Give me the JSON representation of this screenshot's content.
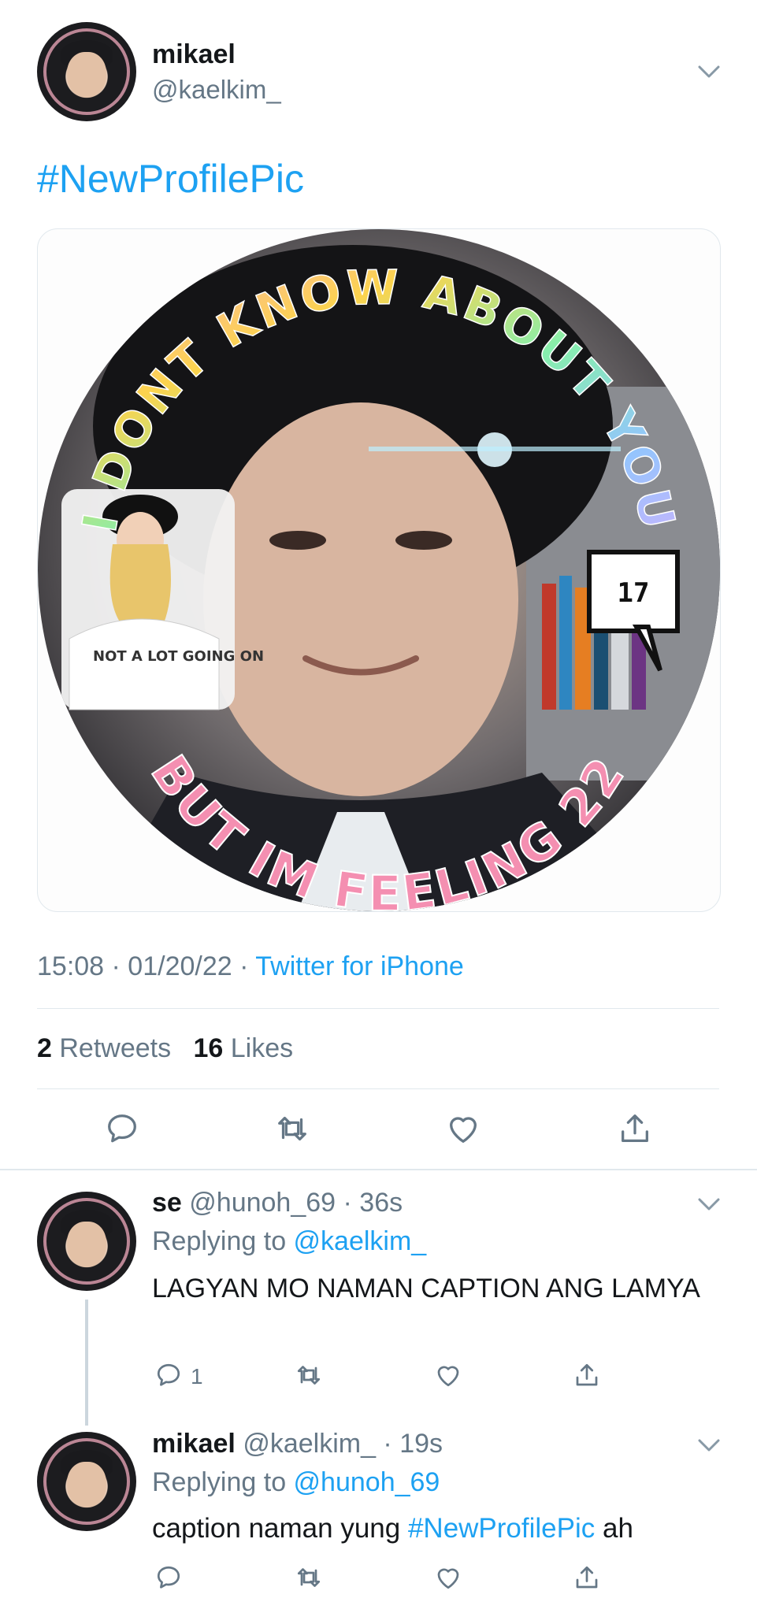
{
  "tweet": {
    "author_name": "mikael",
    "author_handle": "@kaelkim_",
    "text_hashtag": "#NewProfilePic",
    "timestamp": "15:08 · 01/20/22 · ",
    "source": "Twitter for iPhone",
    "retweets_count": "2",
    "retweets_label": "Retweets",
    "likes_count": "16",
    "likes_label": "Likes",
    "image_text_top": "I DONT KNOW ABOUT YOU",
    "image_text_bottom": "BUT IM FEELING 22",
    "image_bubble": "17",
    "image_shirt_text": "NOT A LOT GOING ON"
  },
  "replies": [
    {
      "name": "se",
      "handle_time": "@hunoh_69 · 36s",
      "replying_label": "Replying to ",
      "replying_to": "@kaelkim_",
      "text": "LAGYAN MO NAMAN CAPTION ANG LAMYA",
      "reply_count": "1"
    },
    {
      "name": "mikael",
      "handle_time": "@kaelkim_ · 19s",
      "replying_label": "Replying to ",
      "replying_to": "@hunoh_69",
      "text_before": "caption naman yung ",
      "text_hashtag": "#NewProfilePic",
      "text_after": " ah"
    }
  ],
  "icons": {
    "reply": "speech-bubble-icon",
    "retweet": "retweet-arrows-icon",
    "like": "heart-icon",
    "share": "share-upload-icon",
    "more": "chevron-down-icon"
  },
  "colors": {
    "link": "#1da1f2",
    "secondary_text": "#657786",
    "divider": "#e1e8ed",
    "icon": "#657786"
  }
}
